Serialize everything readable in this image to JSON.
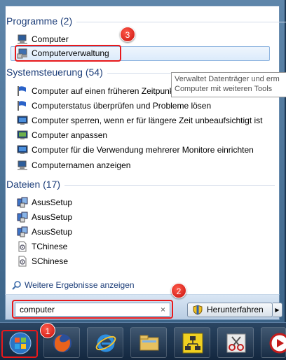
{
  "sections": {
    "programs": "Programme (2)",
    "control_panel": "Systemsteuerung (54)",
    "files": "Dateien (17)"
  },
  "programs": [
    {
      "label": "Computer",
      "icon": "computer-icon"
    },
    {
      "label": "Computerverwaltung",
      "icon": "computer-management-icon"
    }
  ],
  "control_panel": [
    {
      "label": "Computer auf einen früheren Zeitpunkt zurücksetzen",
      "icon": "flag-icon"
    },
    {
      "label": "Computerstatus überprüfen und Probleme lösen",
      "icon": "flag-icon"
    },
    {
      "label": "Computer sperren, wenn er für längere Zeit unbeaufsichtigt ist",
      "icon": "monitor-icon"
    },
    {
      "label": "Computer anpassen",
      "icon": "monitor-icon"
    },
    {
      "label": "Computer für die Verwendung mehrerer Monitore einrichten",
      "icon": "monitor-icon"
    },
    {
      "label": "Computernamen anzeigen",
      "icon": "computer-icon"
    }
  ],
  "files": [
    {
      "label": "AsusSetup",
      "icon": "setup-icon"
    },
    {
      "label": "AsusSetup",
      "icon": "setup-icon"
    },
    {
      "label": "AsusSetup",
      "icon": "setup-icon"
    },
    {
      "label": "TChinese",
      "icon": "ini-file-icon"
    },
    {
      "label": "SChinese",
      "icon": "ini-file-icon"
    }
  ],
  "tooltip": {
    "line1": "Verwaltet Datenträger und erm",
    "line2": "Computer mit weiteren Tools"
  },
  "more_results": "Weitere Ergebnisse anzeigen",
  "search": {
    "value": "computer",
    "clear": "×"
  },
  "shutdown": {
    "label": "Herunterfahren",
    "arrow": "▶"
  },
  "badges": {
    "one": "1",
    "two": "2",
    "three": "3"
  },
  "taskbar": [
    "start-orb-icon",
    "firefox-icon",
    "internet-explorer-icon",
    "explorer-icon",
    "network-icon",
    "snipping-tool-icon",
    "media-player-icon"
  ],
  "colors": {
    "annotation": "#e8191b",
    "section_text": "#1e3f7a",
    "selection": "#dcebfb"
  }
}
